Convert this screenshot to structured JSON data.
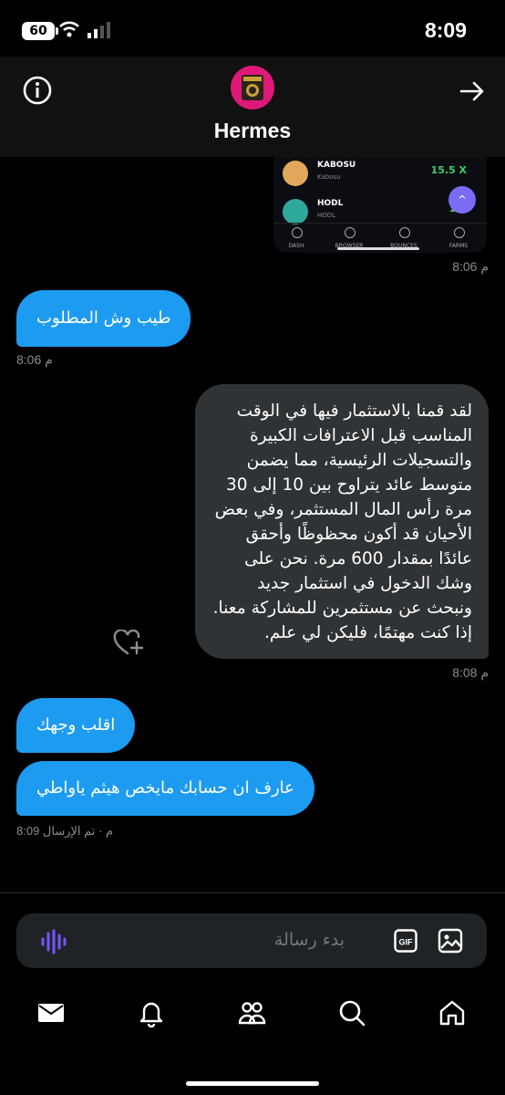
{
  "status": {
    "battery": "60",
    "time": "8:09"
  },
  "header": {
    "contact_name": "Hermes"
  },
  "shared_screenshot": {
    "rows": [
      {
        "name": "KABOSU",
        "sub": "Kabosu",
        "value": "15.5 X"
      },
      {
        "name": "HODL",
        "sub": "HODL",
        "value": "11."
      }
    ],
    "nav": [
      "DASH",
      "BROWSER",
      "BOUNCES",
      "FARMS"
    ]
  },
  "messages": [
    {
      "type": "time",
      "text": "8:06 م"
    },
    {
      "type": "in",
      "text": "طيب وش المطلوب"
    },
    {
      "type": "time",
      "text": "8:06 م"
    },
    {
      "type": "out",
      "text": "لقد قمنا بالاستثمار فيها في الوقت المناسب قبل الاعترافات الكبيرة والتسجيلات الرئيسية، مما يضمن متوسط عائد يتراوح بين 10 إلى 30 مرة رأس المال المستثمر، وفي بعض الأحيان قد أكون محظوظًا وأحقق عائدًا بمقدار 600 مرة. نحن على وشك الدخول في استثمار جديد ونبحث عن مستثمرين للمشاركة معنا. إذا كنت مهتمًا، فليكن لي علم."
    },
    {
      "type": "time",
      "text": "8:08 م"
    },
    {
      "type": "in",
      "text": "اقلب وجهك"
    },
    {
      "type": "in",
      "text": "عارف ان حسابك مايخص هيثم ياواطي"
    },
    {
      "type": "time",
      "text": "8:09 م · تم الإرسال"
    }
  ],
  "composer": {
    "placeholder": "بدء رسالة",
    "gif_label": "GIF"
  },
  "icons": {
    "info": "info-icon",
    "forward": "arrow-right-icon",
    "voice": "voice-wave-icon",
    "gif": "gif-icon",
    "image": "image-icon",
    "heart_add": "heart-plus-icon",
    "nav": [
      "mail-icon",
      "bell-icon",
      "people-icon",
      "search-icon",
      "home-icon"
    ]
  },
  "colors": {
    "bubble_in": "#1d9bf0",
    "bubble_out": "#2f3336",
    "background": "#000000",
    "accent_voice": "#7856ff"
  }
}
